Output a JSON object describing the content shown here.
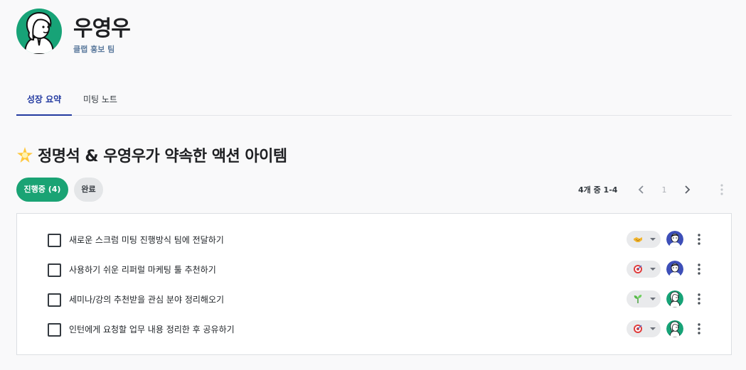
{
  "profile": {
    "name": "우영우",
    "team": "클랩 홍보 팀"
  },
  "tabs": [
    {
      "label": "성장 요약",
      "active": true
    },
    {
      "label": "미팅 노트",
      "active": false
    }
  ],
  "section": {
    "title": "정명석 & 우영우가 약속한 액션 아이템",
    "icon": "sparkle-star-icon"
  },
  "filters": [
    {
      "label": "진행중 (4)",
      "active": true
    },
    {
      "label": "완료",
      "active": false
    }
  ],
  "pagination": {
    "summary": "4개 중 1-4",
    "current_page": "1"
  },
  "colors": {
    "accent": "#1aa374",
    "tab_active": "#233aa0",
    "assignee_blue": "#3d4fb8",
    "assignee_green": "#17a377"
  },
  "items": [
    {
      "text": "새로운 스크럼 미팅 진행방식 팀에 전달하기",
      "category_icon": "handshake-icon",
      "assignee": "blue-avatar",
      "done": false
    },
    {
      "text": "사용하기 쉬운 리퍼럴 마케팅 툴 추천하기",
      "category_icon": "target-icon",
      "assignee": "blue-avatar",
      "done": false
    },
    {
      "text": "세미나/강의 추천받을 관심 분야 정리해오기",
      "category_icon": "sprout-icon",
      "assignee": "green-avatar",
      "done": false
    },
    {
      "text": "인턴에게 요청할 업무 내용 정리한 후 공유하기",
      "category_icon": "target-icon",
      "assignee": "green-avatar",
      "done": false
    }
  ]
}
